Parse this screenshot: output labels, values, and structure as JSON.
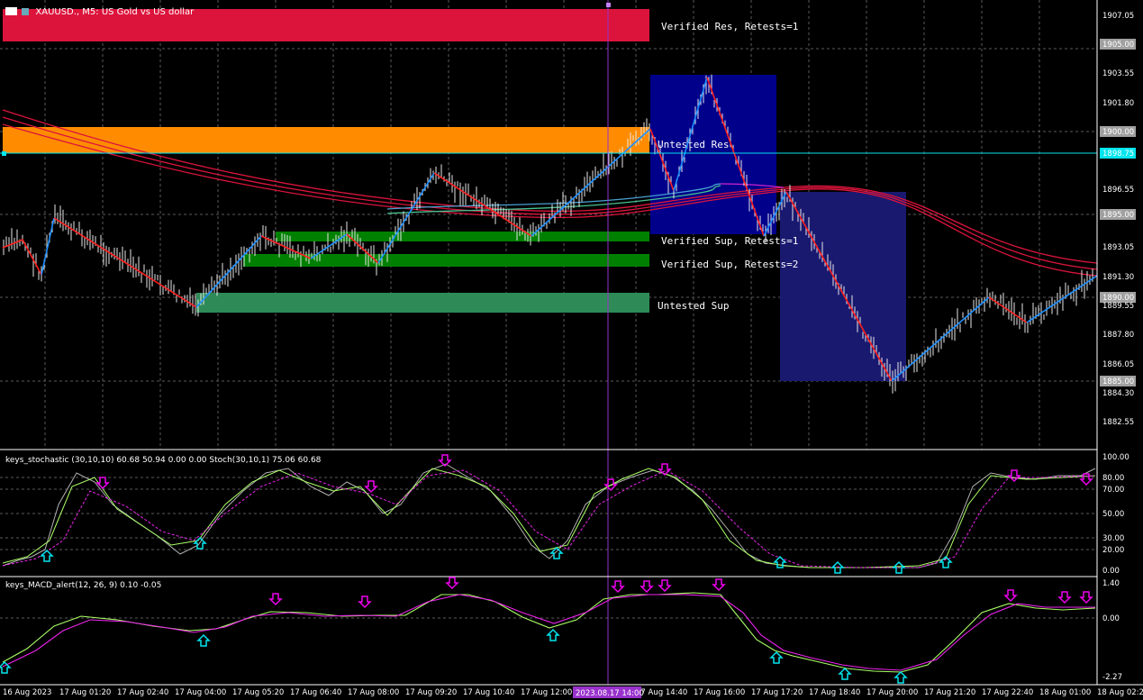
{
  "window": {
    "title": "XAUUSD., M5: US Gold vs US dollar",
    "menu_icon": "chart-menu-icon"
  },
  "zones": [
    {
      "name": "verified-res",
      "label": "Verified Res, Retests=1",
      "color": "#dc143c"
    },
    {
      "name": "untested-res",
      "label": "Untested Res",
      "color": "#ff8c00"
    },
    {
      "name": "verified-sup-1",
      "label": "Verified Sup, Retests=1",
      "color": "#008000"
    },
    {
      "name": "verified-sup-2",
      "label": "Verified Sup, Retests=2",
      "color": "#008000"
    },
    {
      "name": "untested-sup",
      "label": "Untested Sup",
      "color": "#2e8b57"
    }
  ],
  "price_axis": {
    "ticks": [
      "1907.05",
      "1905.00",
      "1903.55",
      "1901.80",
      "1900.00",
      "1898.75",
      "1896.55",
      "1895.00",
      "1893.05",
      "1891.30",
      "1890.00",
      "1889.55",
      "1887.80",
      "1886.05",
      "1885.00",
      "1884.30",
      "1882.55"
    ],
    "current_price": "1898.75",
    "current_price_color": "#00e5ee"
  },
  "stoch": {
    "header": "keys_stochastic (30,10,10) 60.68 50.94 0.00 0.00 Stoch(30,10,1) 75.06 60.68",
    "ticks": [
      "100.00",
      "80.00",
      "70.00",
      "50.00",
      "30.00",
      "20.00",
      "0.00"
    ]
  },
  "macd": {
    "header": "keys_MACD_alert(12, 26, 9) 0.10 -0.05",
    "ticks": [
      "1.40",
      "0.00",
      "-2.27"
    ]
  },
  "time_axis": {
    "labels": [
      "16 Aug 2023",
      "17 Aug 01:20",
      "17 Aug 02:40",
      "17 Aug 04:00",
      "17 Aug 05:20",
      "17 Aug 06:40",
      "17 Aug 08:00",
      "17 Aug 09:20",
      "17 Aug 10:40",
      "17 Aug 12:00",
      "17 Aug 14:40",
      "17 Aug 16:00",
      "17 Aug 17:20",
      "17 Aug 18:40",
      "17 Aug 20:00",
      "17 Aug 21:20",
      "17 Aug 22:40",
      "18 Aug 01:00",
      "18 Aug 02:2"
    ],
    "crosshair_label": "2023.08.17 14:00",
    "crosshair_color": "#9932cc"
  },
  "colors": {
    "bull_swing": "#1e90ff",
    "bear_swing": "#ff2020",
    "ma_red": "#dc143c",
    "signal_up": "#00e5ee",
    "signal_down": "#ee00ee",
    "box_dark": "#00008b",
    "box_mid": "#191970"
  }
}
